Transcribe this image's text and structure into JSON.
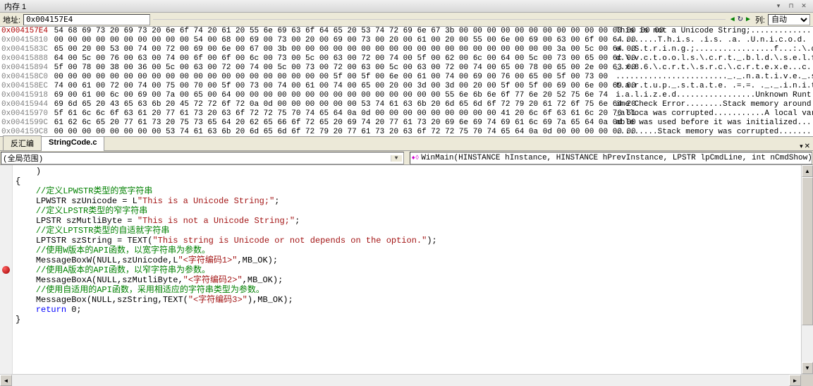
{
  "window": {
    "title": "内存 1"
  },
  "address_bar": {
    "label": "地址:",
    "value": "0x004157E4",
    "column_label": "列:",
    "column_value": "自动"
  },
  "hex": {
    "rows": [
      {
        "addr": "0x004157E4",
        "hex": "54 68 69 73 20 69 73 20 6e 6f 74 20 61 20 55 6e 69 63 6f 64 65 20 53 74 72 69 6e 67 3b 00 00 00 00 00 00 00 00 00 00 00 00 00 00 00",
        "ascii": "This is not a Unicode String;...............",
        "selected": true
      },
      {
        "addr": "0x00415810",
        "hex": "00 00 00 00 00 00 00 00 00 00 54 00 68 00 69 00 73 00 20 00 69 00 73 00 20 00 61 00 20 00 55 00 6e 00 69 00 63 00 6f 00 64 00",
        "ascii": ".........T.h.i.s. .i.s. .a. .U.n.i.c.o.d."
      },
      {
        "addr": "0x0041583C",
        "hex": "65 00 20 00 53 00 74 00 72 00 69 00 6e 00 67 00 3b 00 00 00 00 00 00 00 00 00 00 00 00 00 00 00 00 00 00 00 3a 00 5c 00 64 00",
        "ascii": "e. .S.t.r.i.n.g.;.................f...:.\\.d."
      },
      {
        "addr": "0x00415888",
        "hex": "64 00 5c 00 76 00 63 00 74 00 6f 00 6f 00 6c 00 73 00 5c 00 63 00 72 00 74 00 5f 00 62 00 6c 00 64 00 5c 00 73 00 65 00 6c 00",
        "ascii": "d.\\.v.c.t.o.o.l.s.\\.c.r.t._.b.l.d.\\.s.e.l.f."
      },
      {
        "addr": "0x00415894",
        "hex": "5f 00 78 00 38 00 36 00 5c 00 63 00 72 00 74 00 5c 00 73 00 72 00 63 00 5c 00 63 00 72 00 74 00 65 00 78 00 65 00 2e 00 63 00",
        "ascii": "_.x.8.6.\\.c.r.t.\\.s.r.c.\\.c.r.t.e.x.e...c..."
      },
      {
        "addr": "0x004158C0",
        "hex": "00 00 00 00 00 00 00 00 00 00 00 00 00 00 00 00 00 00 00 00 5f 00 5f 00 6e 00 61 00 74 00 69 00 76 00 65 00 5f 00 73 00",
        "ascii": "........................_._.n.a.t.i.v.e._.s."
      },
      {
        "addr": "0x004158EC",
        "hex": "74 00 61 00 72 00 74 00 75 00 70 00 5f 00 73 00 74 00 61 00 74 00 65 00 20 00 3d 00 3d 00 20 00 5f 00 5f 00 69 00 6e 00 69 00",
        "ascii": "t.a.r.t.u.p._.s.t.a.t.e. .=.=. ._._.i.n.i.t."
      },
      {
        "addr": "0x00415918",
        "hex": "69 00 61 00 6c 00 69 00 7a 00 65 00 64 00 00 00 00 00 00 00 00 00 00 00 00 00 00 00 55 6e 6b 6e 6f 77 6e 20 52 75 6e 74",
        "ascii": "i.a.l.i.z.e.d.................Unknown Runt"
      },
      {
        "addr": "0x00415944",
        "hex": "69 6d 65 20 43 65 63 6b 20 45 72 72 6f 72 0a 0d 00 00 00 00 00 00 53 74 61 63 6b 20 6d 65 6d 6f 72 79 20 61 72 6f 75 6e 64 20",
        "ascii": "ime Check Error........Stack memory around "
      },
      {
        "addr": "0x00415970",
        "hex": "5f 61 6c 6c 6f 63 61 20 77 61 73 20 63 6f 72 72 75 70 74 65 64 0a 0d 00 00 00 00 00 00 00 00 00 41 20 6c 6f 63 61 6c 20 76 61",
        "ascii": "_alloca was corrupted...........A local vari"
      },
      {
        "addr": "0x0041599C",
        "hex": "61 62 6c 65 20 77 61 73 20 75 73 65 64 20 62 65 66 6f 72 65 20 69 74 20 77 61 73 20 69 6e 69 74 69 61 6c 69 7a 65 64 0a 0d 00",
        "ascii": "able was used before it was initialized....."
      },
      {
        "addr": "0x004159C8",
        "hex": "00 00 00 00 00 00 00 00 53 74 61 63 6b 20 6d 65 6d 6f 72 79 20 77 61 73 20 63 6f 72 72 75 70 74 65 64 0a 0d 00 00 00 00 00 00",
        "ascii": ".........Stack memory was corrupted........."
      }
    ]
  },
  "tabs": {
    "items": [
      {
        "label": "反汇编",
        "active": false
      },
      {
        "label": "StringCode.c",
        "active": true
      }
    ]
  },
  "dropdowns": {
    "scope": "(全局范围)",
    "function": "WinMain(HINSTANCE hInstance, HINSTANCE hPrevInstance, LPSTR lpCmdLine, int nCmdShow)"
  },
  "code": {
    "lines": [
      {
        "indent": 1,
        "parts": [
          {
            "t": "plain",
            "v": ")"
          }
        ]
      },
      {
        "indent": 0,
        "parts": [
          {
            "t": "plain",
            "v": "{"
          }
        ]
      },
      {
        "indent": 1,
        "parts": [
          {
            "t": "comment",
            "v": "//定义LPWSTR类型的宽字符串"
          }
        ]
      },
      {
        "indent": 1,
        "parts": [
          {
            "t": "type",
            "v": "LPWSTR szUnicode = L"
          },
          {
            "t": "string",
            "v": "\"This is a Unicode String;\""
          },
          {
            "t": "plain",
            "v": ";"
          }
        ]
      },
      {
        "indent": 1,
        "parts": [
          {
            "t": "comment",
            "v": "//定义LPSTR类型的窄字符串"
          }
        ]
      },
      {
        "indent": 1,
        "parts": [
          {
            "t": "type",
            "v": "LPSTR szMutliByte = "
          },
          {
            "t": "string",
            "v": "\"This is not a Unicode String;\""
          },
          {
            "t": "plain",
            "v": ";"
          }
        ]
      },
      {
        "indent": 1,
        "parts": [
          {
            "t": "comment",
            "v": "//定义LPTSTR类型的自适就字符串"
          }
        ]
      },
      {
        "indent": 1,
        "parts": [
          {
            "t": "type",
            "v": "LPTSTR szString = TEXT("
          },
          {
            "t": "string",
            "v": "\"This string is Unicode or not depends on the option.\""
          },
          {
            "t": "plain",
            "v": ");"
          }
        ]
      },
      {
        "indent": 0,
        "parts": [
          {
            "t": "plain",
            "v": ""
          }
        ]
      },
      {
        "indent": 1,
        "parts": [
          {
            "t": "comment",
            "v": "//使用W版本的API函数，以宽字符串为参数。"
          }
        ]
      },
      {
        "indent": 1,
        "parts": [
          {
            "t": "plain",
            "v": "MessageBoxW(NULL,szUnicode,L"
          },
          {
            "t": "string",
            "v": "\"<字符编码1>\""
          },
          {
            "t": "plain",
            "v": ",MB_OK);"
          }
        ],
        "bp": true
      },
      {
        "indent": 1,
        "parts": [
          {
            "t": "comment",
            "v": "//使用A版本的API函数，以窄字符串为参数。"
          }
        ]
      },
      {
        "indent": 1,
        "parts": [
          {
            "t": "plain",
            "v": "MessageBoxA(NULL,szMutliByte,"
          },
          {
            "t": "string",
            "v": "\"<字符编码2>\""
          },
          {
            "t": "plain",
            "v": ",MB_OK);"
          }
        ]
      },
      {
        "indent": 1,
        "parts": [
          {
            "t": "comment",
            "v": "//使用自适用的API函数，采用相适应的字符串类型为参数。"
          }
        ]
      },
      {
        "indent": 1,
        "parts": [
          {
            "t": "plain",
            "v": "MessageBox(NULL,szString,TEXT("
          },
          {
            "t": "string",
            "v": "\"<字符编码3>\""
          },
          {
            "t": "plain",
            "v": "),MB_OK);"
          }
        ]
      },
      {
        "indent": 0,
        "parts": [
          {
            "t": "plain",
            "v": ""
          }
        ]
      },
      {
        "indent": 1,
        "parts": [
          {
            "t": "keyword",
            "v": "return"
          },
          {
            "t": "plain",
            "v": " 0;"
          }
        ]
      },
      {
        "indent": 0,
        "parts": [
          {
            "t": "plain",
            "v": "}"
          }
        ]
      }
    ]
  }
}
